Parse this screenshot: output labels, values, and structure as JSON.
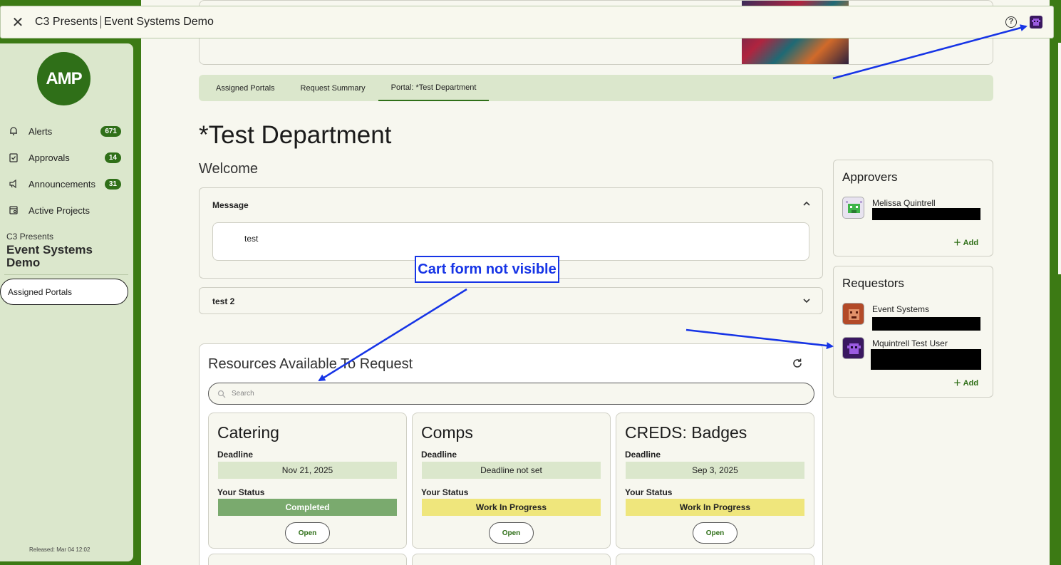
{
  "window": {
    "org": "C3 Presents",
    "project": "Event Systems Demo",
    "close_icon": "close-icon",
    "help_icon": "help-icon"
  },
  "sidebar": {
    "logo_text": "AMP",
    "nav": [
      {
        "label": "Alerts",
        "badge": "671",
        "icon": "bell-icon"
      },
      {
        "label": "Approvals",
        "badge": "14",
        "icon": "clipboard-check-icon"
      },
      {
        "label": "Announcements",
        "badge": "31",
        "icon": "megaphone-icon"
      },
      {
        "label": "Active Projects",
        "badge": "",
        "icon": "projects-icon"
      }
    ],
    "org_sub": "C3 Presents",
    "org_name": "Event Systems Demo",
    "assigned_label": "Assigned Portals",
    "released": "Released: Mar 04 12:02"
  },
  "tabs": [
    {
      "label": "Assigned Portals"
    },
    {
      "label": "Request Summary"
    },
    {
      "label": "Portal: *Test Department",
      "active": true
    }
  ],
  "page": {
    "title": "*Test Department",
    "welcome": "Welcome"
  },
  "accordions": [
    {
      "title": "Message",
      "content": "test",
      "expanded": true
    },
    {
      "title": "test 2",
      "expanded": false
    }
  ],
  "resources": {
    "title": "Resources Available To Request",
    "search_placeholder": "Search",
    "deadline_label": "Deadline",
    "status_label": "Your Status",
    "open_label": "Open",
    "cards": [
      {
        "name": "Catering",
        "deadline": "Nov 21, 2025",
        "status": "Completed"
      },
      {
        "name": "Comps",
        "deadline": "Deadline not set",
        "status": "Work In Progress"
      },
      {
        "name": "CREDS: Badges",
        "deadline": "Sep 3, 2025",
        "status": "Work In Progress"
      }
    ]
  },
  "approvers": {
    "title": "Approvers",
    "people": [
      {
        "name": "Melissa Quintrell"
      }
    ],
    "add_label": "Add"
  },
  "requestors": {
    "title": "Requestors",
    "people": [
      {
        "name": "Event Systems"
      },
      {
        "name": "Mquintrell Test User"
      }
    ],
    "add_label": "Add"
  },
  "annotation": {
    "callout": "Cart form not visible",
    "color": "#1634e6"
  },
  "colors": {
    "brand_green": "#3c7a14",
    "completed": "#7aaa6e",
    "in_progress": "#efe67c"
  }
}
